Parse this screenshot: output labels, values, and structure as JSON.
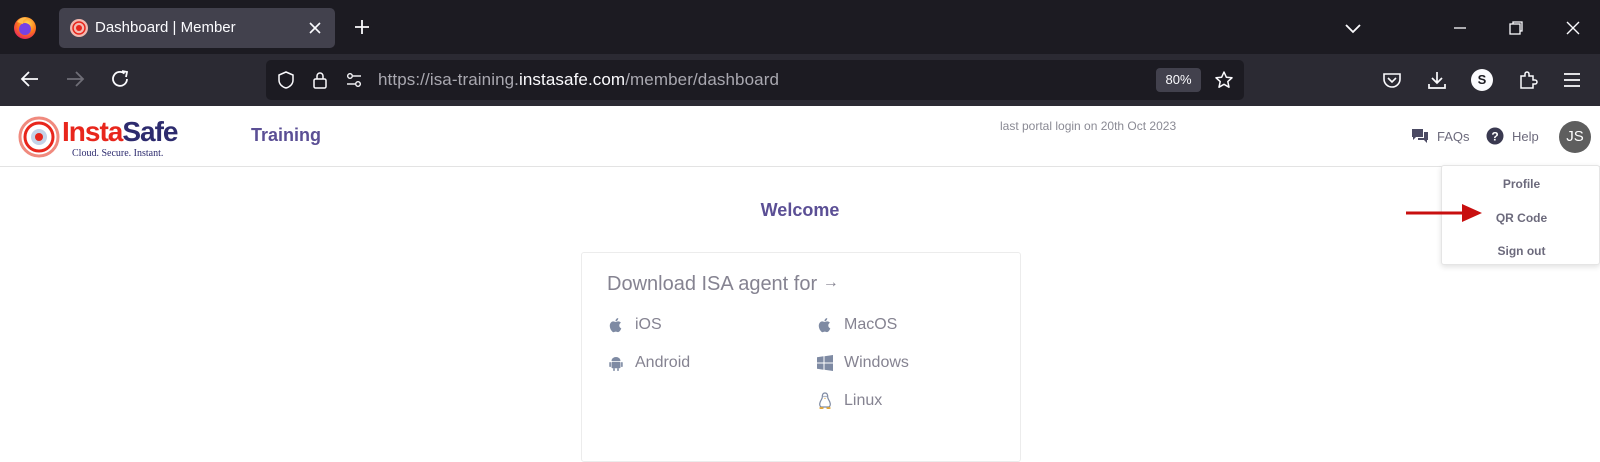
{
  "browser": {
    "tab_title": "Dashboard | Member",
    "url_prefix": "https://isa-training.",
    "url_host": "instasafe.com",
    "url_path": "/member/dashboard",
    "zoom": "80%",
    "account_initial": "S"
  },
  "header": {
    "logo_brand_part1": "Insta",
    "logo_brand_part2": "Safe",
    "logo_tagline": "Cloud. Secure. Instant.",
    "section_title": "Training",
    "last_login": "last portal login on 20th Oct 2023",
    "faqs_label": "FAQs",
    "help_label": "Help",
    "avatar_initials": "JS"
  },
  "user_menu": {
    "items": [
      "Profile",
      "QR Code",
      "Sign out"
    ]
  },
  "main": {
    "welcome": "Welcome",
    "download_title": "Download ISA agent for",
    "download_arrow": "→",
    "platforms": {
      "ios": "iOS",
      "macos": "MacOS",
      "android": "Android",
      "windows": "Windows",
      "linux": "Linux"
    }
  },
  "colors": {
    "accent": "#5b4f95",
    "annotation_arrow": "#c80f0f",
    "brand_red": "#e8261c",
    "brand_navy": "#2d2b6e"
  }
}
